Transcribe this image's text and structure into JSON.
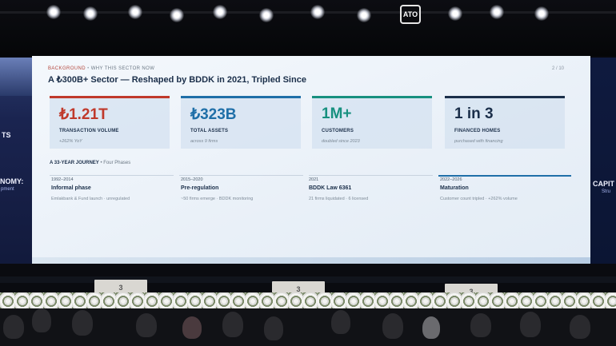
{
  "slide": {
    "eyebrow_primary": "BACKGROUND",
    "eyebrow_sep": "•",
    "eyebrow_secondary": "WHY THIS SECTOR NOW",
    "page": "2 / 10",
    "title": "A ₺300B+ Sector — Reshaped by BDDK in 2021, Tripled Since",
    "cards": [
      {
        "value": "₺1.21T",
        "label": "TRANSACTION VOLUME",
        "note": "+262% YoY",
        "color": "#c0392b"
      },
      {
        "value": "₺323B",
        "label": "TOTAL ASSETS",
        "note": "across 9 firms",
        "color": "#1f6fa8"
      },
      {
        "value": "1M+",
        "label": "CUSTOMERS",
        "note": "doubled since 2023",
        "color": "#17907f"
      },
      {
        "value": "1 in 3",
        "label": "FINANCED HOMES",
        "note": "purchased with financing",
        "color": "#1b2f4a"
      }
    ],
    "journey": {
      "heading": "A 33-YEAR JOURNEY",
      "sub": "•  Four Phases",
      "phases": [
        {
          "years": "1992–2014",
          "name": "Informal phase",
          "desc": "Emlakbank & Fund launch  ·  unregulated"
        },
        {
          "years": "2015–2020",
          "name": "Pre-regulation",
          "desc": "~50 firms emerge  ·  BDDK monitoring"
        },
        {
          "years": "2021",
          "name": "BDDK Law 6361",
          "desc": "21 firms liquidated  ·  6 licensed"
        },
        {
          "years": "2022–2026",
          "name": "Maturation",
          "desc": "Customer count tripled  ·  +262% volume"
        }
      ]
    }
  },
  "venue": {
    "left_wall_line1": "NOMY:",
    "left_wall_line2": "pment",
    "left_wall_top": "TS",
    "right_wall_line1": "CAPIT",
    "right_wall_line2": "Stru",
    "podium_mark": "3",
    "truss_logo": "ATO"
  },
  "colors": {
    "screen_bg": "#eef3f9",
    "navy": "#1b2f4a",
    "accent_red": "#c0392b",
    "accent_blue": "#1f6fa8",
    "accent_teal": "#17907f"
  }
}
